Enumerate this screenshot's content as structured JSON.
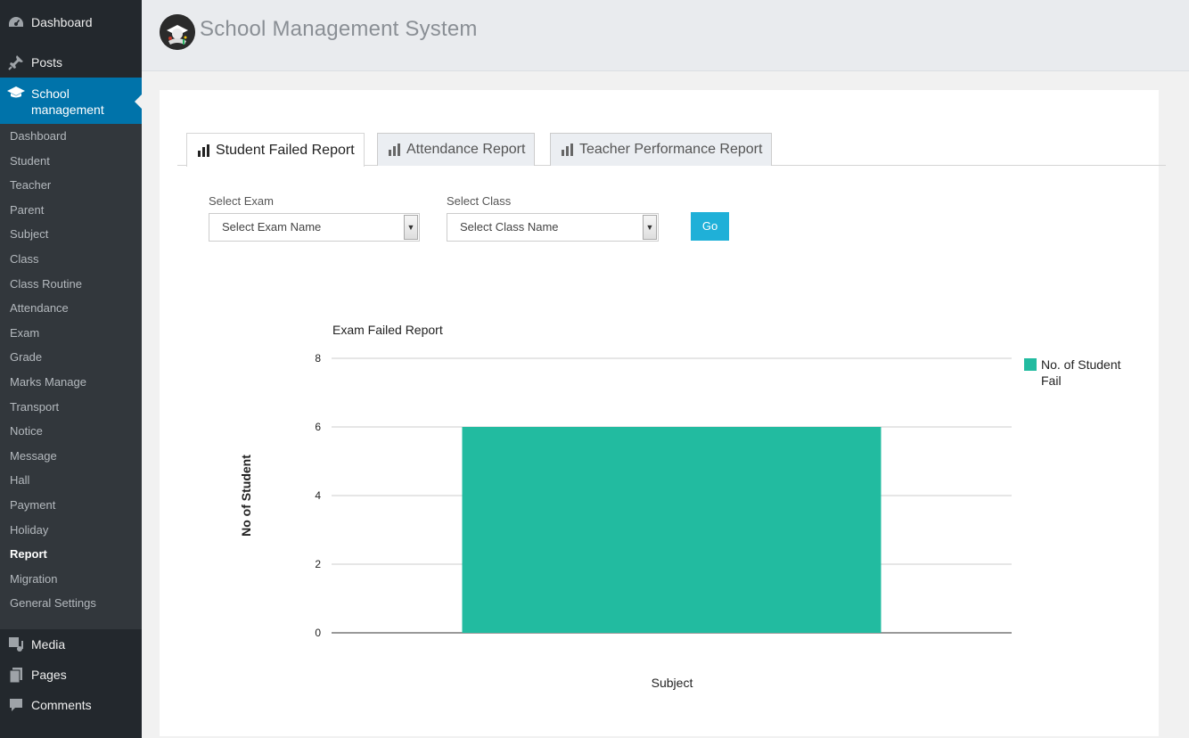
{
  "app": {
    "title": "School Management System"
  },
  "sidebar": {
    "top": [
      {
        "label": "Dashboard",
        "icon": "dashboard-icon"
      },
      {
        "label": "Posts",
        "icon": "pin-icon"
      },
      {
        "label": "School management",
        "icon": "graduation-cap-icon"
      }
    ],
    "submenu": [
      "Dashboard",
      "Student",
      "Teacher",
      "Parent",
      "Subject",
      "Class",
      "Class Routine",
      "Attendance",
      "Exam",
      "Grade",
      "Marks Manage",
      "Transport",
      "Notice",
      "Message",
      "Hall",
      "Payment",
      "Holiday",
      "Report",
      "Migration",
      "General Settings"
    ],
    "current": "Report",
    "bottom": [
      {
        "label": "Media",
        "icon": "media-icon"
      },
      {
        "label": "Pages",
        "icon": "pages-icon"
      },
      {
        "label": "Comments",
        "icon": "comment-icon"
      }
    ]
  },
  "tabs": [
    {
      "label": "Student Failed Report",
      "active": true
    },
    {
      "label": "Attendance Report",
      "active": false
    },
    {
      "label": "Teacher Performance Report",
      "active": false
    }
  ],
  "filters": {
    "exam_label": "Select Exam",
    "exam_value": "Select Exam Name",
    "class_label": "Select Class",
    "class_value": "Select Class Name",
    "go_label": "Go"
  },
  "colors": {
    "accent": "#0073aa",
    "bar": "#22bba0",
    "go": "#1fb0d8"
  },
  "chart_data": {
    "type": "bar",
    "title": "Exam Failed Report",
    "xlabel": "Subject",
    "ylabel": "No of Student",
    "categories": [
      ""
    ],
    "series": [
      {
        "name": "No. of Student Fail",
        "values": [
          6
        ]
      }
    ],
    "ylim": [
      0,
      8
    ],
    "yticks": [
      0,
      2,
      4,
      6,
      8
    ],
    "grid": true,
    "legend": "right"
  }
}
